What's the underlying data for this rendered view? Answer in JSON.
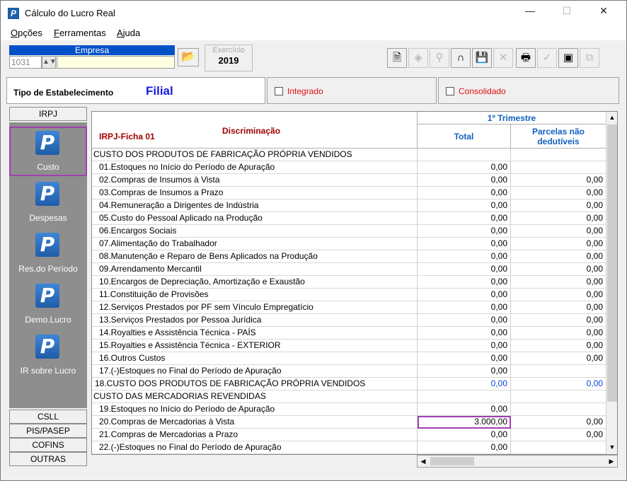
{
  "window": {
    "title": "Cálculo do Lucro Real",
    "minimize": "—",
    "maximize": "☐",
    "close": "✕"
  },
  "menu": [
    {
      "prefix": "",
      "ul": "O",
      "rest": "pções"
    },
    {
      "prefix": "",
      "ul": "F",
      "rest": "erramentas"
    },
    {
      "prefix": "",
      "ul": "A",
      "rest": "juda"
    }
  ],
  "empresa": {
    "header": "Empresa",
    "code": "1031",
    "name": ""
  },
  "exercicio": {
    "label": "Exercício",
    "value": "2019"
  },
  "toolbar_icons": [
    "document-icon",
    "diamond-icon",
    "search-user-icon",
    "headphones-icon",
    "save-icon",
    "delete-icon",
    "print-icon",
    "check-icon",
    "copy-icon",
    "export-icon"
  ],
  "estabelecimento": {
    "label": "Tipo de Estabelecimento",
    "value": "Filial"
  },
  "checks": {
    "integrado": "Integrado",
    "consolidado": "Consolidado"
  },
  "sidebar": {
    "top": "IRPJ",
    "items": [
      "Custo",
      "Despesas",
      "Res.do Período",
      "Demo.Lucro",
      "IR sobre Lucro"
    ],
    "bottom": [
      "CSLL",
      "PIS/PASEP",
      "COFINS",
      "OUTRAS"
    ]
  },
  "grid": {
    "ficha": "IRPJ-Ficha 01",
    "discriminacao": "Discriminação",
    "trimestre": "1º Trimestre",
    "col_total": "Total",
    "col_parcelas": "Parcelas não dedutíveis",
    "rows": [
      {
        "type": "sec",
        "desc": "CUSTO DOS PRODUTOS DE FABRICAÇÃO PRÓPRIA VENDIDOS",
        "total": "",
        "parc": ""
      },
      {
        "type": "item",
        "desc": "01.Estoques no Início do Período de Apuração",
        "total": "0,00",
        "parc": ""
      },
      {
        "type": "item",
        "desc": "02.Compras de Insumos à Vista",
        "total": "0,00",
        "parc": "0,00"
      },
      {
        "type": "item",
        "desc": "03.Compras de Insumos a Prazo",
        "total": "0,00",
        "parc": "0,00"
      },
      {
        "type": "item",
        "desc": "04.Remuneração a Dirigentes de Indústria",
        "total": "0,00",
        "parc": "0,00"
      },
      {
        "type": "item",
        "desc": "05.Custo do Pessoal Aplicado na Produção",
        "total": "0,00",
        "parc": "0,00"
      },
      {
        "type": "item",
        "desc": "06.Encargos Sociais",
        "total": "0,00",
        "parc": "0,00"
      },
      {
        "type": "item",
        "desc": "07.Alimentação do Trabalhador",
        "total": "0,00",
        "parc": "0,00"
      },
      {
        "type": "item",
        "desc": "08.Manutenção e Reparo de Bens Aplicados na Produção",
        "total": "0,00",
        "parc": "0,00"
      },
      {
        "type": "item",
        "desc": "09.Arrendamento Mercantil",
        "total": "0,00",
        "parc": "0,00"
      },
      {
        "type": "item",
        "desc": "10.Encargos de Depreciação, Amortização e Exaustão",
        "total": "0,00",
        "parc": "0,00"
      },
      {
        "type": "item",
        "desc": "11.Constituição de Provisões",
        "total": "0,00",
        "parc": "0,00"
      },
      {
        "type": "item",
        "desc": "12.Serviços Prestados por PF sem Vínculo Empregatício",
        "total": "0,00",
        "parc": "0,00"
      },
      {
        "type": "item",
        "desc": "13.Serviços Prestados por Pessoa Jurídica",
        "total": "0,00",
        "parc": "0,00"
      },
      {
        "type": "item",
        "desc": "14.Royalties e Assistência Técnica - PAÍS",
        "total": "0,00",
        "parc": "0,00"
      },
      {
        "type": "item",
        "desc": "15.Royalties e Assistência Técnica - EXTERIOR",
        "total": "0,00",
        "parc": "0,00"
      },
      {
        "type": "item",
        "desc": "16.Outros Custos",
        "total": "0,00",
        "parc": "0,00"
      },
      {
        "type": "item",
        "desc": "17.(-)Estoques no Final do Período de Apuração",
        "total": "0,00",
        "parc": ""
      },
      {
        "type": "tot",
        "desc": "18.CUSTO DOS PRODUTOS DE FABRICAÇÃO PRÓPRIA VENDIDOS",
        "total": "0,00",
        "parc": "0,00"
      },
      {
        "type": "sec",
        "desc": "CUSTO DAS MERCADORIAS REVENDIDAS",
        "total": "",
        "parc": ""
      },
      {
        "type": "item",
        "desc": "19.Estoques no Início do Período de Apuração",
        "total": "0,00",
        "parc": ""
      },
      {
        "type": "item",
        "desc": "20.Compras de Mercadorias à Vista",
        "total": "3.000,00",
        "parc": "0,00",
        "highlight": true
      },
      {
        "type": "item",
        "desc": "21.Compras de Mercadorias a Prazo",
        "total": "0,00",
        "parc": "0,00"
      },
      {
        "type": "item",
        "desc": "22.(-)Estoques no Final do Período de Apuração",
        "total": "0,00",
        "parc": ""
      }
    ]
  }
}
